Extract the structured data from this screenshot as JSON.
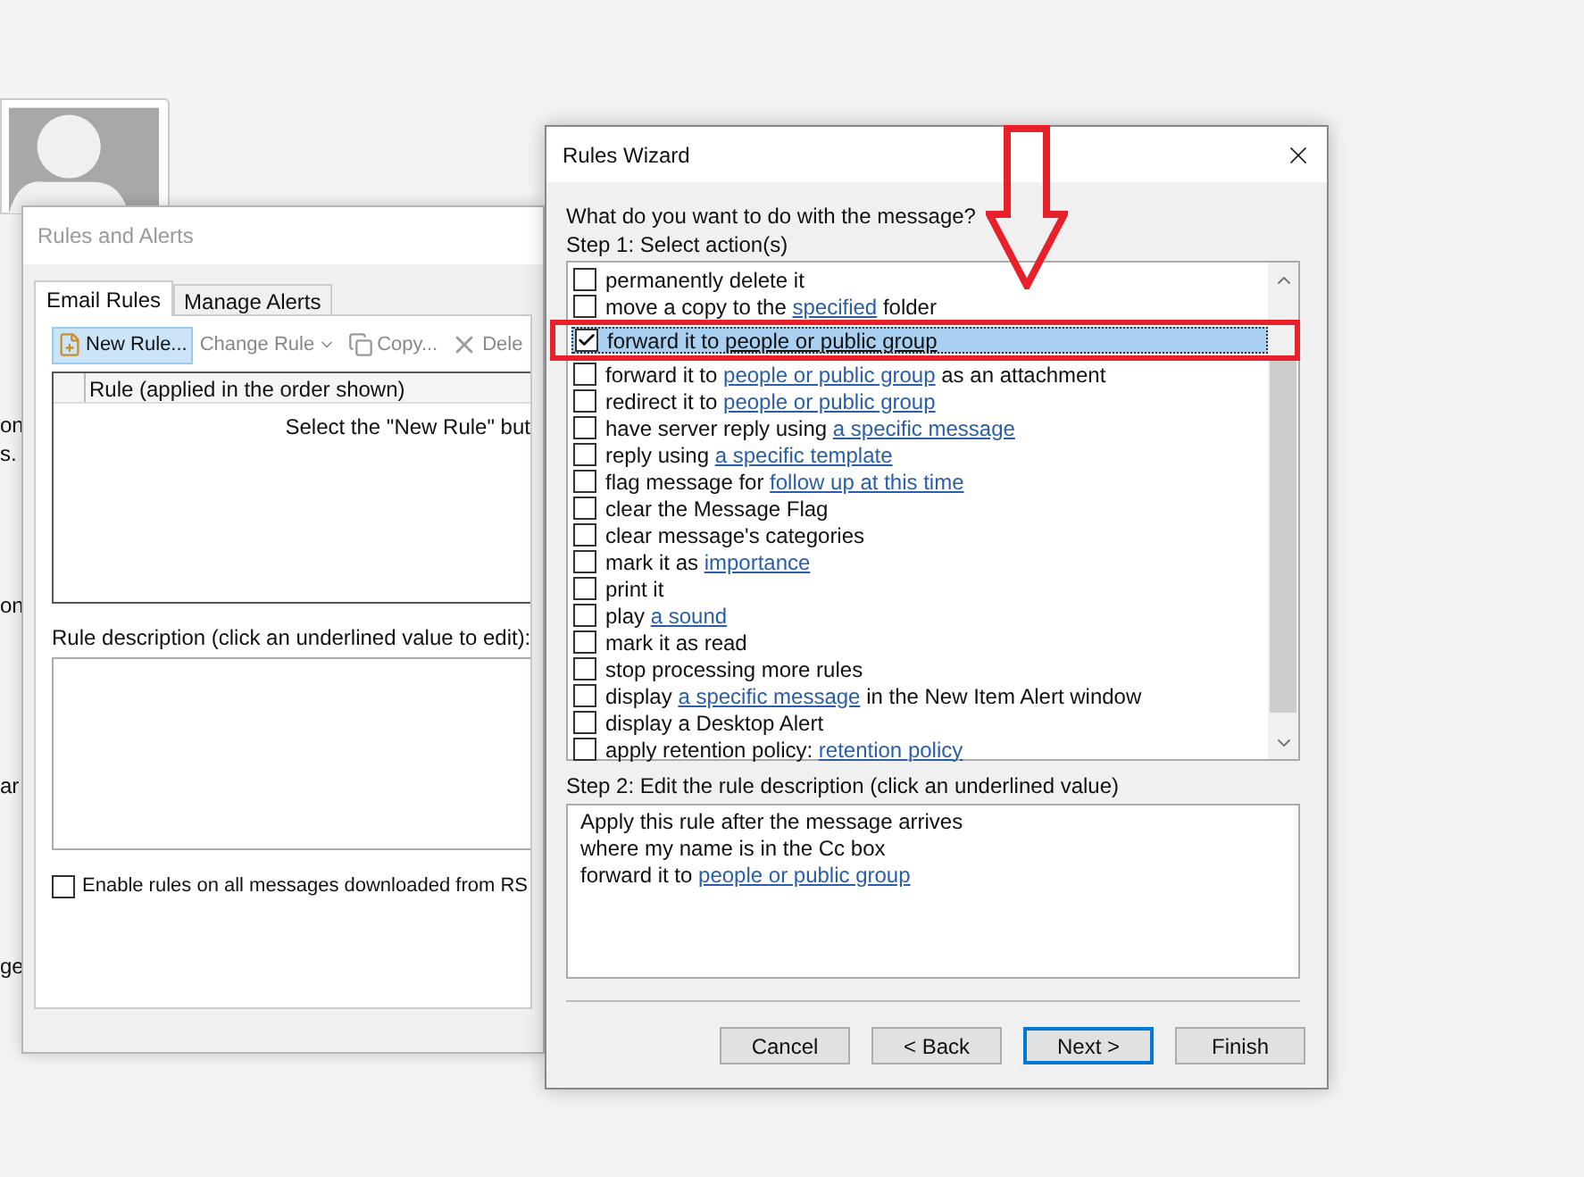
{
  "background_fragments": [
    "on",
    "s.",
    "on",
    "ar",
    "ge"
  ],
  "rules_and_alerts": {
    "title": "Rules and Alerts",
    "tabs": [
      {
        "label": "Email Rules",
        "selected": true
      },
      {
        "label": "Manage Alerts",
        "selected": false
      }
    ],
    "toolbar": [
      {
        "label": "New Rule...",
        "kind": "new",
        "highlighted": true
      },
      {
        "label": "Change Rule",
        "kind": "change",
        "highlighted": false
      },
      {
        "label": "Copy...",
        "kind": "copy",
        "highlighted": false
      },
      {
        "label": "Dele",
        "kind": "delete",
        "highlighted": false
      }
    ],
    "table": {
      "columns": [
        "Rule (applied in the order shown)"
      ],
      "empty_text": "Select the \"New Rule\" but"
    },
    "description_label": "Rule description (click an underlined value to edit):",
    "rss_option": {
      "label": "Enable rules on all messages downloaded from RS",
      "checked": false
    }
  },
  "rules_wizard": {
    "title": "Rules Wizard",
    "question": "What do you want to do with the message?",
    "step1_label": "Step 1: Select action(s)",
    "actions": [
      {
        "checked": false,
        "selected": false,
        "segments": [
          {
            "kind": "plain",
            "text": "permanently delete it"
          }
        ]
      },
      {
        "checked": false,
        "selected": false,
        "segments": [
          {
            "kind": "plain",
            "text": "move a copy to the "
          },
          {
            "kind": "link",
            "text": "specified"
          },
          {
            "kind": "plain",
            "text": " folder"
          }
        ]
      },
      {
        "checked": true,
        "selected": true,
        "segments": [
          {
            "kind": "plain",
            "text": "forward it to "
          },
          {
            "kind": "link",
            "text": "people or public group"
          }
        ]
      },
      {
        "checked": false,
        "selected": false,
        "segments": [
          {
            "kind": "plain",
            "text": "forward it to "
          },
          {
            "kind": "link",
            "text": "people or public group"
          },
          {
            "kind": "plain",
            "text": " as an attachment"
          }
        ]
      },
      {
        "checked": false,
        "selected": false,
        "segments": [
          {
            "kind": "plain",
            "text": "redirect it to "
          },
          {
            "kind": "link",
            "text": "people or public group"
          }
        ]
      },
      {
        "checked": false,
        "selected": false,
        "segments": [
          {
            "kind": "plain",
            "text": "have server reply using "
          },
          {
            "kind": "link",
            "text": "a specific message"
          }
        ]
      },
      {
        "checked": false,
        "selected": false,
        "segments": [
          {
            "kind": "plain",
            "text": "reply using "
          },
          {
            "kind": "link",
            "text": "a specific template"
          }
        ]
      },
      {
        "checked": false,
        "selected": false,
        "segments": [
          {
            "kind": "plain",
            "text": "flag message for "
          },
          {
            "kind": "link",
            "text": "follow up at this time"
          }
        ]
      },
      {
        "checked": false,
        "selected": false,
        "segments": [
          {
            "kind": "plain",
            "text": "clear the Message Flag"
          }
        ]
      },
      {
        "checked": false,
        "selected": false,
        "segments": [
          {
            "kind": "plain",
            "text": "clear message's categories"
          }
        ]
      },
      {
        "checked": false,
        "selected": false,
        "segments": [
          {
            "kind": "plain",
            "text": "mark it as "
          },
          {
            "kind": "link",
            "text": "importance"
          }
        ]
      },
      {
        "checked": false,
        "selected": false,
        "segments": [
          {
            "kind": "plain",
            "text": "print it"
          }
        ]
      },
      {
        "checked": false,
        "selected": false,
        "segments": [
          {
            "kind": "plain",
            "text": "play "
          },
          {
            "kind": "link",
            "text": "a sound"
          }
        ]
      },
      {
        "checked": false,
        "selected": false,
        "segments": [
          {
            "kind": "plain",
            "text": "mark it as read"
          }
        ]
      },
      {
        "checked": false,
        "selected": false,
        "segments": [
          {
            "kind": "plain",
            "text": "stop processing more rules"
          }
        ]
      },
      {
        "checked": false,
        "selected": false,
        "segments": [
          {
            "kind": "plain",
            "text": "display "
          },
          {
            "kind": "link",
            "text": "a specific message"
          },
          {
            "kind": "plain",
            "text": " in the New Item Alert window"
          }
        ]
      },
      {
        "checked": false,
        "selected": false,
        "segments": [
          {
            "kind": "plain",
            "text": "display a Desktop Alert"
          }
        ]
      },
      {
        "checked": false,
        "selected": false,
        "segments": [
          {
            "kind": "plain",
            "text": "apply retention policy: "
          },
          {
            "kind": "link",
            "text": "retention policy"
          }
        ]
      }
    ],
    "step2_label": "Step 2: Edit the rule description (click an underlined value)",
    "description_lines": [
      [
        {
          "kind": "plain",
          "text": "Apply this rule after the message arrives"
        }
      ],
      [
        {
          "kind": "plain",
          "text": "where my name is in the Cc box"
        }
      ],
      [
        {
          "kind": "plain",
          "text": "forward it to "
        },
        {
          "kind": "link",
          "text": "people or public group"
        }
      ]
    ],
    "buttons": [
      {
        "label": "Cancel",
        "default": false
      },
      {
        "label": "< Back",
        "default": false
      },
      {
        "label": "Next >",
        "default": true
      },
      {
        "label": "Finish",
        "default": false
      }
    ]
  }
}
